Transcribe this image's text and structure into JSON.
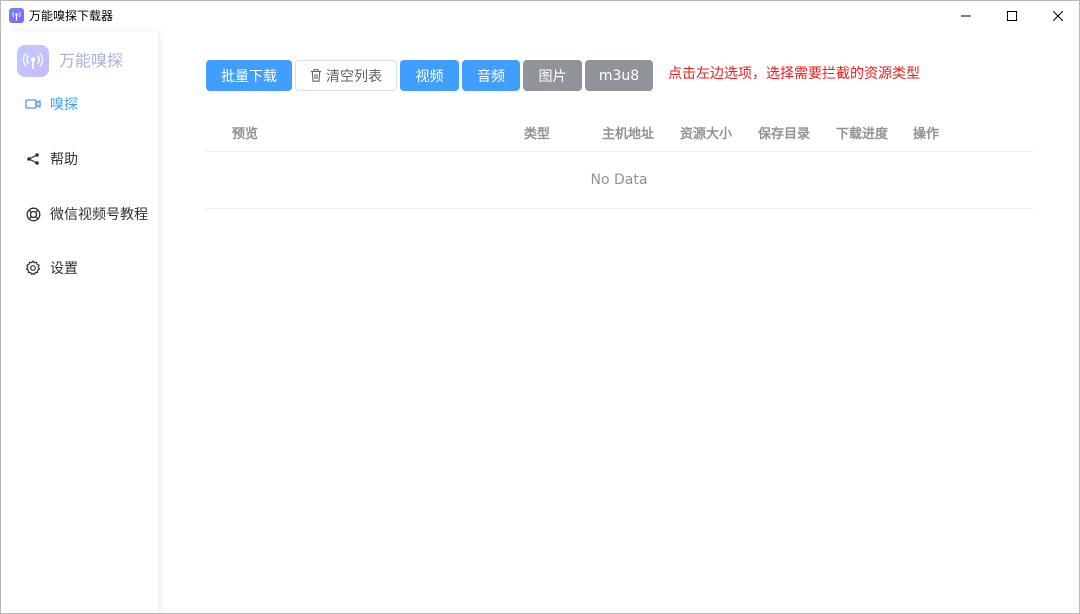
{
  "window": {
    "title": "万能嗅探下载器",
    "icon": "antenna-icon"
  },
  "sidebar": {
    "brand": "万能嗅探",
    "items": [
      {
        "label": "嗅探",
        "icon": "video-camera-icon",
        "active": true
      },
      {
        "label": "帮助",
        "icon": "share-icon",
        "active": false
      },
      {
        "label": "微信视频号教程",
        "icon": "lifebuoy-icon",
        "active": false
      },
      {
        "label": "设置",
        "icon": "gear-icon",
        "active": false
      }
    ]
  },
  "toolbar": {
    "batch_download": "批量下载",
    "clear_list": "清空列表",
    "filters": [
      {
        "label": "视频",
        "state": "selected"
      },
      {
        "label": "音频",
        "state": "selected"
      },
      {
        "label": "图片",
        "state": "unselected"
      },
      {
        "label": "m3u8",
        "state": "unselected"
      }
    ],
    "hint": "点击左边选项，选择需要拦截的资源类型"
  },
  "table": {
    "columns": [
      "预览",
      "类型",
      "主机地址",
      "资源大小",
      "保存目录",
      "下载进度",
      "操作"
    ],
    "empty_text": "No Data"
  },
  "colors": {
    "primary": "#409eff",
    "inactive_filter": "#909399",
    "hint": "#f21c1c"
  }
}
